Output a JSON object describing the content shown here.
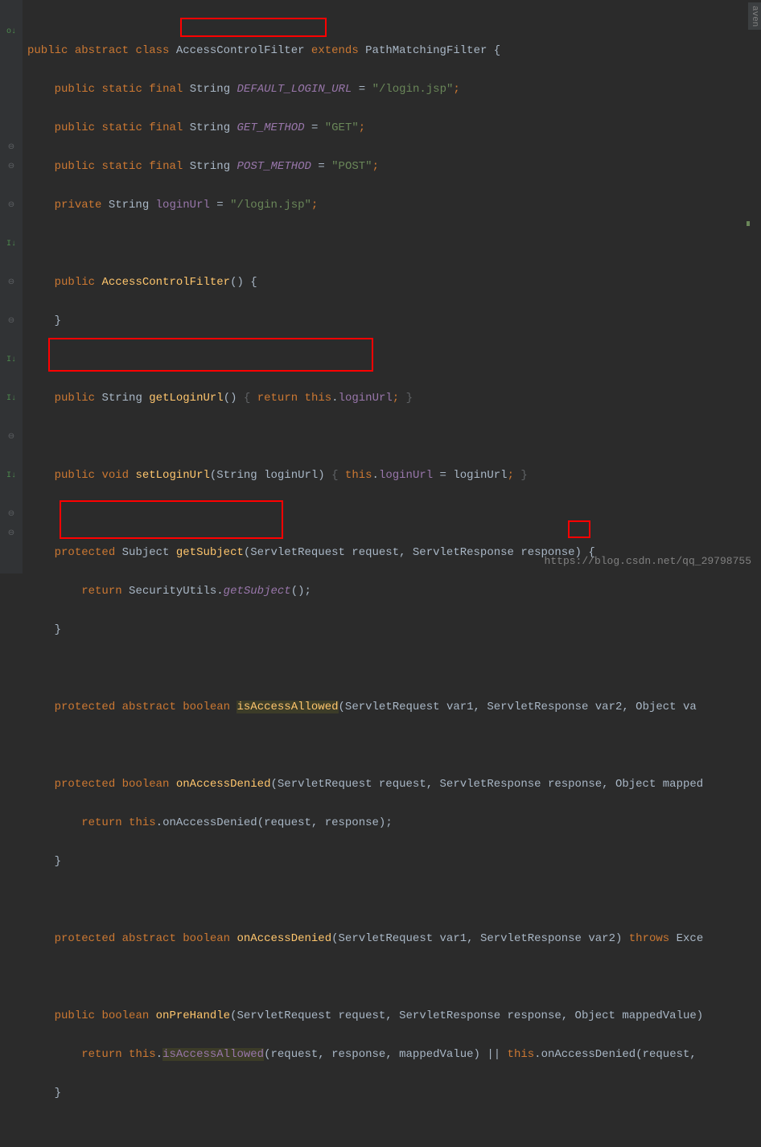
{
  "code": {
    "l1": {
      "kw1": "public",
      "kw2": "abstract",
      "kw3": "class",
      "name": "AccessControlFilter",
      "kw4": "extends",
      "super": "PathMatchingFilter",
      "brace": "{"
    },
    "l2": {
      "kw1": "public",
      "kw2": "static",
      "kw3": "final",
      "type": "String",
      "name": "DEFAULT_LOGIN_URL",
      "eq": "=",
      "val": "\"/login.jsp\"",
      "semi": ";"
    },
    "l3": {
      "kw1": "public",
      "kw2": "static",
      "kw3": "final",
      "type": "String",
      "name": "GET_METHOD",
      "eq": "=",
      "val": "\"GET\"",
      "semi": ";"
    },
    "l4": {
      "kw1": "public",
      "kw2": "static",
      "kw3": "final",
      "type": "String",
      "name": "POST_METHOD",
      "eq": "=",
      "val": "\"POST\"",
      "semi": ";"
    },
    "l5": {
      "kw1": "private",
      "type": "String",
      "name": "loginUrl",
      "eq": "=",
      "val": "\"/login.jsp\"",
      "semi": ";"
    },
    "l7": {
      "kw1": "public",
      "ctor": "AccessControlFilter",
      "paren": "()",
      "brace": "{"
    },
    "l8": {
      "brace": "}"
    },
    "l10": {
      "kw1": "public",
      "type": "String",
      "name": "getLoginUrl",
      "paren": "()",
      "fold1": "{",
      "kw2": "return",
      "this": "this",
      "dot": ".",
      "fld": "loginUrl",
      "semi": ";",
      "fold2": "}"
    },
    "l12": {
      "kw1": "public",
      "kw2": "void",
      "name": "setLoginUrl",
      "p1": "(String loginUrl)",
      "fold1": "{",
      "this": "this",
      "dot": ".",
      "fld": "loginUrl",
      "eq": " = loginUrl",
      "semi": ";",
      "fold2": "}"
    },
    "l14": {
      "kw1": "protected",
      "type": "Subject",
      "name": "getSubject",
      "params": "(ServletRequest request, ServletResponse response) {"
    },
    "l15": {
      "kw1": "return",
      "cls": "SecurityUtils",
      "dot": ".",
      "mtd": "getSubject",
      "paren": "();"
    },
    "l16": {
      "brace": "}"
    },
    "l18": {
      "kw1": "protected",
      "kw2": "abstract",
      "kw3": "boolean",
      "name": "isAccessAllowed",
      "params": "(ServletRequest var1, ServletResponse var2, Object va"
    },
    "l20": {
      "kw1": "protected",
      "kw2": "boolean",
      "name": "onAccessDenied",
      "params": "(ServletRequest request, ServletResponse response, Object mapped"
    },
    "l21": {
      "kw1": "return",
      "this": "this",
      "dot": ".",
      "mtd": "onAccessDenied",
      "params": "(request, response);"
    },
    "l22": {
      "brace": "}"
    },
    "l24": {
      "kw1": "protected",
      "kw2": "abstract",
      "kw3": "boolean",
      "name": "onAccessDenied",
      "params": "(ServletRequest var1, ServletResponse var2)",
      "kw4": "throws",
      "exc": "Exce"
    },
    "l26": {
      "kw1": "public",
      "kw2": "boolean",
      "name": "onPreHandle",
      "params": "(ServletRequest request, ServletResponse response, Object mappedValue)"
    },
    "l27": {
      "kw1": "return",
      "this1": "this",
      "dot1": ".",
      "mtd1": "isAccessAllowed",
      "p1": "(request, response, mappedValue) || ",
      "this2": "this",
      "dot2": ".",
      "mtd2": "onAccessDenied",
      "p2": "(request,"
    },
    "l28": {
      "brace": "}"
    }
  },
  "watermark": "https://blog.csdn.net/qq_29798755",
  "sidetab": "aven",
  "gutter_icons": {
    "override": "o↓",
    "implements": "I↓",
    "collapse": "⊖"
  }
}
